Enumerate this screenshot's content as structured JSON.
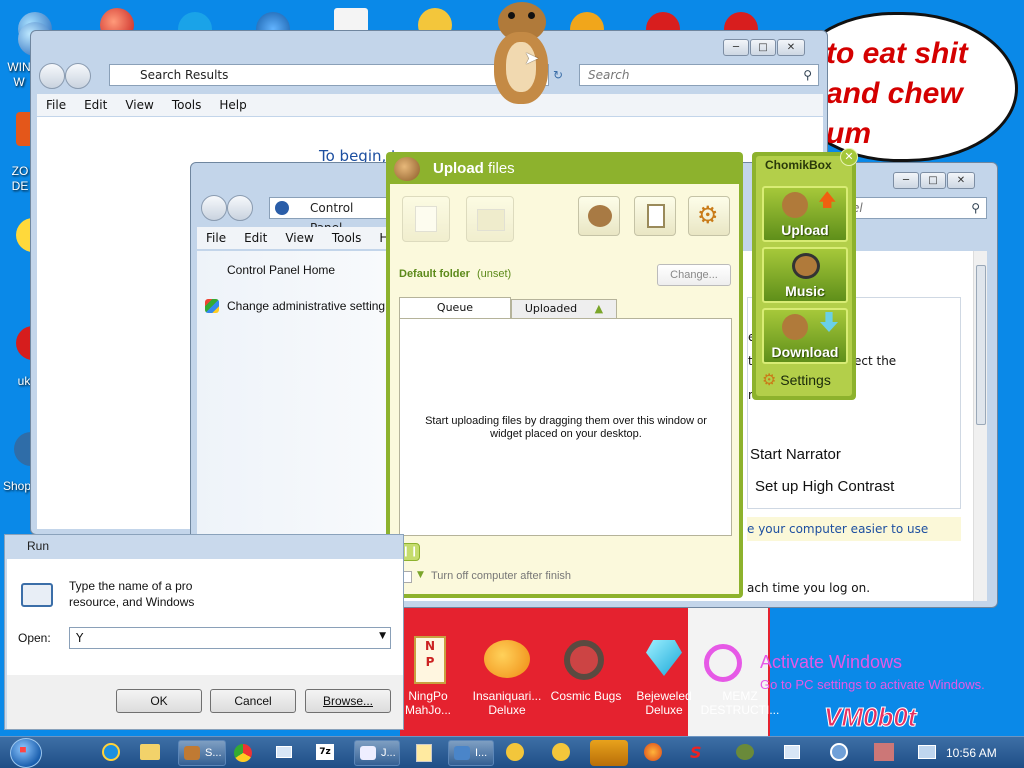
{
  "desktop": {
    "left_icons": [
      {
        "label": "WIN\nW",
        "icon": "globe-icon"
      },
      {
        "label": "ZO\nDE",
        "icon": "zone-icon"
      },
      {
        "label": "uk",
        "icon": "ukiyo-icon"
      },
      {
        "label": "Shop",
        "icon": "shop-icon"
      }
    ],
    "speech_bubble_text": "to eat shit\nand chew\num",
    "game_icons": [
      {
        "label": "NingPo\nMahJo...",
        "icon": "ningpo-icon"
      },
      {
        "label": "Insaniquari...\nDeluxe",
        "icon": "fish-icon"
      },
      {
        "label": "Cosmic Bugs",
        "icon": "gear-icon"
      },
      {
        "label": "Bejeweled\nDeluxe",
        "icon": "diamond-icon"
      },
      {
        "label": "MEMZ\nDESTRUCTI...",
        "icon": "key-icon"
      }
    ],
    "activate_title": "Activate Windows",
    "activate_sub": "Go to PC settings to activate Windows.",
    "watermark": "VM0b0t"
  },
  "explorer_window": {
    "address": "Search Results",
    "search_placeholder": "Search",
    "menu": [
      "File",
      "Edit",
      "View",
      "Tools",
      "Help"
    ],
    "message": "To begin, t"
  },
  "control_panel": {
    "address": "Control Panel",
    "search_placeholder": "el",
    "menu": [
      "File",
      "Edit",
      "View",
      "Tools",
      "Help"
    ],
    "links": [
      "Control Panel Home",
      "Change administrative setting"
    ],
    "right_frags": [
      "ed",
      "th",
      "ect the",
      "n"
    ],
    "items": [
      "Start Narrator",
      "Set up High Contrast"
    ],
    "easier_link": "e your computer easier to use",
    "logon_text": "ach time you log on."
  },
  "upload": {
    "title_bold": "Upload",
    "title_rest": " files",
    "default_folder_label": "Default folder",
    "default_folder_value": "(unset)",
    "change_button": "Change...",
    "tabs": [
      "Queue",
      "Uploaded"
    ],
    "empty_message": "Start uploading files by dragging them over this window or widget placed on your desktop.",
    "turn_off": "Turn off computer after finish"
  },
  "widget": {
    "title": "ChomikBox",
    "tiles": [
      "Upload",
      "Music",
      "Download"
    ],
    "settings": "Settings"
  },
  "run_dialog": {
    "title": "Run",
    "description_line1": "Type the name of a pro",
    "description_line2": "resource, and Windows",
    "open_label": "Open:",
    "open_value": "Y",
    "ok": "OK",
    "cancel": "Cancel",
    "browse": "Browse..."
  },
  "taskbar": {
    "items": [
      {
        "label": "S...",
        "icon": "chomik-icon"
      },
      {
        "label": "J...",
        "icon": "document-icon"
      },
      {
        "label": "I...",
        "icon": "control-panel-icon"
      }
    ],
    "clock": "10:56 AM"
  },
  "colors": {
    "desktop_blue": "#0a89e8",
    "chomik_green": "#8db22d",
    "upload_bg": "#fbf9dc",
    "red_wall": "#e5222f",
    "activate_magenta": "#e659e6"
  }
}
